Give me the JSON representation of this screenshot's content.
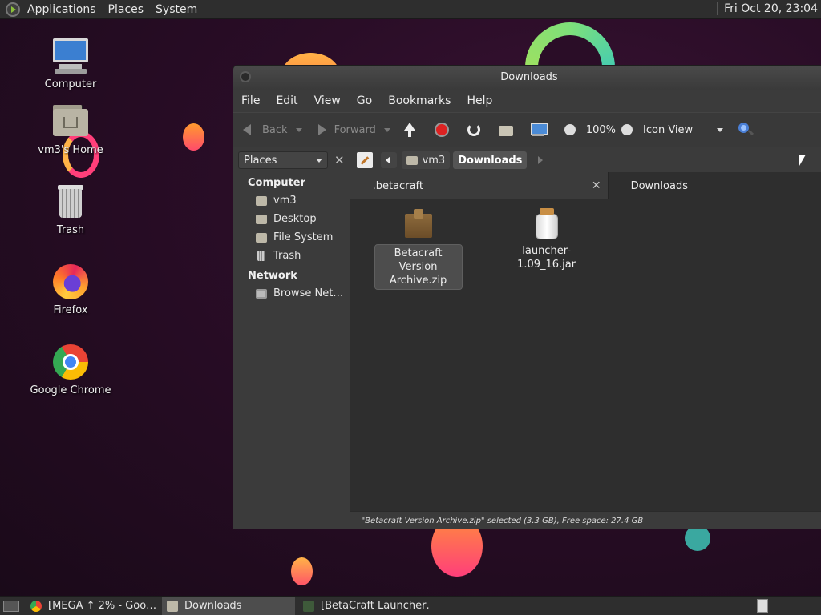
{
  "top_panel": {
    "menus": [
      "Applications",
      "Places",
      "System"
    ],
    "clock": "Fri Oct 20, 23:04"
  },
  "desktop_icons": [
    {
      "label": "Computer",
      "icon": "computer-icon"
    },
    {
      "label": "vm3's Home",
      "icon": "home-folder-icon"
    },
    {
      "label": "Trash",
      "icon": "trash-icon"
    },
    {
      "label": "Firefox",
      "icon": "firefox-icon"
    },
    {
      "label": "Google Chrome",
      "icon": "chrome-icon"
    }
  ],
  "window": {
    "title": "Downloads",
    "menubar": [
      "File",
      "Edit",
      "View",
      "Go",
      "Bookmarks",
      "Help"
    ],
    "toolbar": {
      "back": "Back",
      "forward": "Forward",
      "zoom": "100%",
      "view_mode": "Icon View"
    },
    "sidebar": {
      "selector": "Places",
      "sections": [
        {
          "title": "Computer",
          "items": [
            "vm3",
            "Desktop",
            "File System",
            "Trash"
          ]
        },
        {
          "title": "Network",
          "items": [
            "Browse Net…"
          ]
        }
      ]
    },
    "pathbar": {
      "crumbs": [
        "vm3",
        "Downloads"
      ]
    },
    "tabs": [
      {
        "label": ".betacraft",
        "active": false
      },
      {
        "label": "Downloads",
        "active": true
      }
    ],
    "files": [
      {
        "name": "Betacraft Version Archive.zip",
        "icon": "zip-archive-icon",
        "selected": true
      },
      {
        "name": "launcher-1.09_16.jar",
        "icon": "jar-file-icon",
        "selected": false
      }
    ],
    "status": "\"Betacraft Version Archive.zip\" selected (3.3 GB), Free space: 27.4 GB"
  },
  "taskbar": {
    "tasks": [
      {
        "label": "[MEGA ↑ 2% - Goo…",
        "icon": "chrome-icon",
        "active": false
      },
      {
        "label": "Downloads",
        "icon": "folder-icon",
        "active": true
      },
      {
        "label": "[BetaCraft Launcher…",
        "icon": "betacraft-icon",
        "active": false
      }
    ]
  }
}
